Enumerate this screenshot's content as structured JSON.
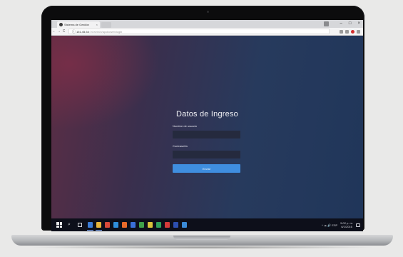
{
  "browser": {
    "tab_title": "Sistema de Gestión",
    "tab_close": "×",
    "window_controls": [
      "–",
      "□",
      "×"
    ],
    "nav_buttons": [
      "←",
      "→",
      "C",
      "ⓘ"
    ],
    "url_host": "151.45.54",
    "url_path": ":7000/000/apolloweb/login"
  },
  "login": {
    "title": "Datos de Ingreso",
    "username_label": "Nombre de usuario",
    "password_label": "Contraseña",
    "username_value": "",
    "password_value": "",
    "submit_label": "Enviar"
  },
  "taskbar": {
    "search_glyph": "⌕",
    "apps": [
      {
        "name": "edge",
        "color": "#3b7bd6"
      },
      {
        "name": "file-explorer",
        "color": "#e8b53a"
      },
      {
        "name": "chrome",
        "color": "#d84a3a"
      },
      {
        "name": "store",
        "color": "#2f8fdc"
      },
      {
        "name": "app-orange",
        "color": "#e86a2a"
      },
      {
        "name": "app-blue",
        "color": "#3a6fd8"
      },
      {
        "name": "app-green",
        "color": "#3fa04a"
      },
      {
        "name": "app-yellow",
        "color": "#d9c23a"
      },
      {
        "name": "app-green-2",
        "color": "#2fa05a"
      },
      {
        "name": "app-red",
        "color": "#d53a3a"
      },
      {
        "name": "app-navy",
        "color": "#2c4fb0"
      },
      {
        "name": "app-blue-2",
        "color": "#3a8ad8"
      }
    ],
    "tray_glyphs": "^ ☁ 🔊 ESP",
    "clock_time": "5:02 p. m.",
    "clock_date": "6/1/2016"
  },
  "colors": {
    "accent_button": "#3f8ee0",
    "input_background": "#252a3e",
    "page_gradient_start": "#5b2e45",
    "page_gradient_end": "#20365a"
  }
}
